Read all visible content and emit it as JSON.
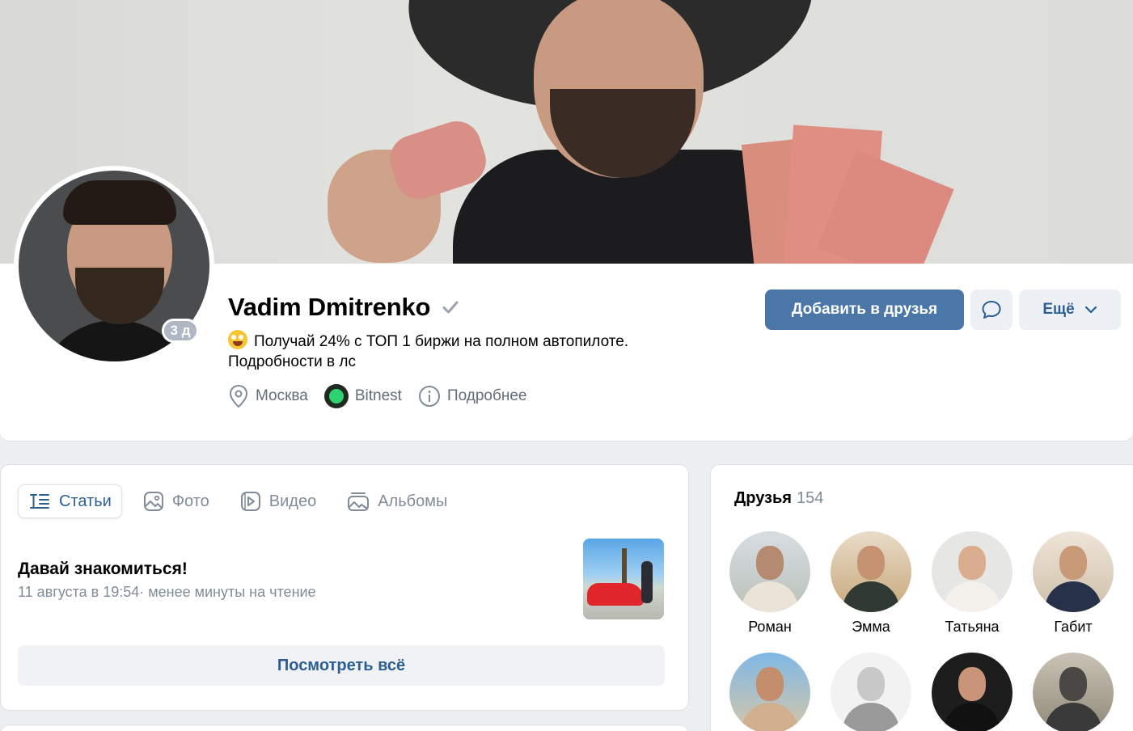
{
  "profile": {
    "name": "Vadim Dmitrenko",
    "online_badge": "3 д",
    "status_line1": "Получай 24% с ТОП 1 биржи на полном автопилоте.",
    "status_line2": "Подробности в лс",
    "city": "Москва",
    "company": "Bitnest",
    "details_link": "Подробнее"
  },
  "actions": {
    "add_friend": "Добавить в друзья",
    "more": "Ещё"
  },
  "tabs": [
    {
      "label": "Статьи",
      "icon": "articles-icon",
      "active": true
    },
    {
      "label": "Фото",
      "icon": "photo-icon",
      "active": false
    },
    {
      "label": "Видео",
      "icon": "video-icon",
      "active": false
    },
    {
      "label": "Альбомы",
      "icon": "albums-icon",
      "active": false
    }
  ],
  "article": {
    "title": "Давай знакомиться!",
    "meta": "11 августа в 19:54· менее минуты на чтение",
    "see_all": "Посмотреть всё"
  },
  "friends": {
    "title": "Друзья",
    "count": "154",
    "items": [
      {
        "name": "Роман"
      },
      {
        "name": "Эмма"
      },
      {
        "name": "Татьяна"
      },
      {
        "name": "Габит"
      },
      {
        "name": ""
      },
      {
        "name": ""
      },
      {
        "name": ""
      },
      {
        "name": ""
      }
    ]
  },
  "colors": {
    "primary": "#4a76a8",
    "link": "#2c5e93",
    "muted": "#818c99",
    "background": "#edeef0"
  }
}
